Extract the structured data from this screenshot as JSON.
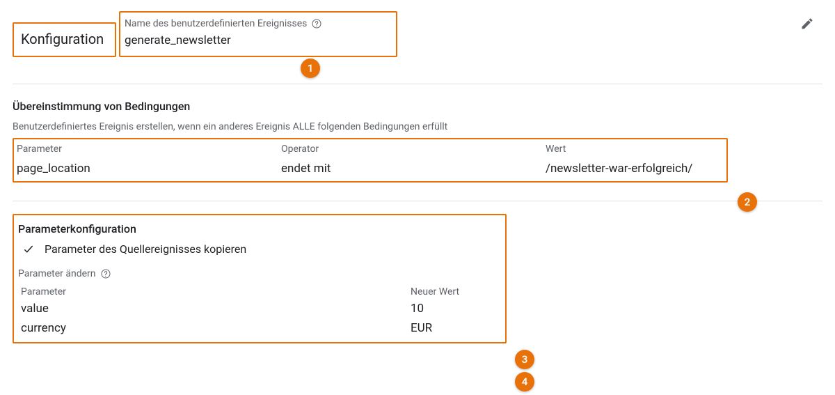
{
  "header": {
    "title": "Konfiguration"
  },
  "eventName": {
    "label": "Name des benutzerdefinierten Ereignisses",
    "value": "generate_newsletter"
  },
  "conditions": {
    "heading": "Übereinstimmung von Bedingungen",
    "description": "Benutzerdefiniertes Ereignis erstellen, wenn ein anderes Ereignis ALLE folgenden Bedingungen erfüllt",
    "columns": {
      "param": "Parameter",
      "op": "Operator",
      "val": "Wert"
    },
    "rows": [
      {
        "param": "page_location",
        "op": "endet mit",
        "val": "/newsletter-war-erfolgreich/"
      }
    ]
  },
  "paramConfig": {
    "heading": "Parameterkonfiguration",
    "copy_label": "Parameter des Quellereignisses kopieren",
    "modify_label": "Parameter ändern",
    "columns": {
      "param": "Parameter",
      "val": "Neuer Wert"
    },
    "rows": [
      {
        "param": "value",
        "val": "10"
      },
      {
        "param": "currency",
        "val": "EUR"
      }
    ]
  },
  "markers": {
    "m1": "1",
    "m2": "2",
    "m3": "3",
    "m4": "4"
  }
}
